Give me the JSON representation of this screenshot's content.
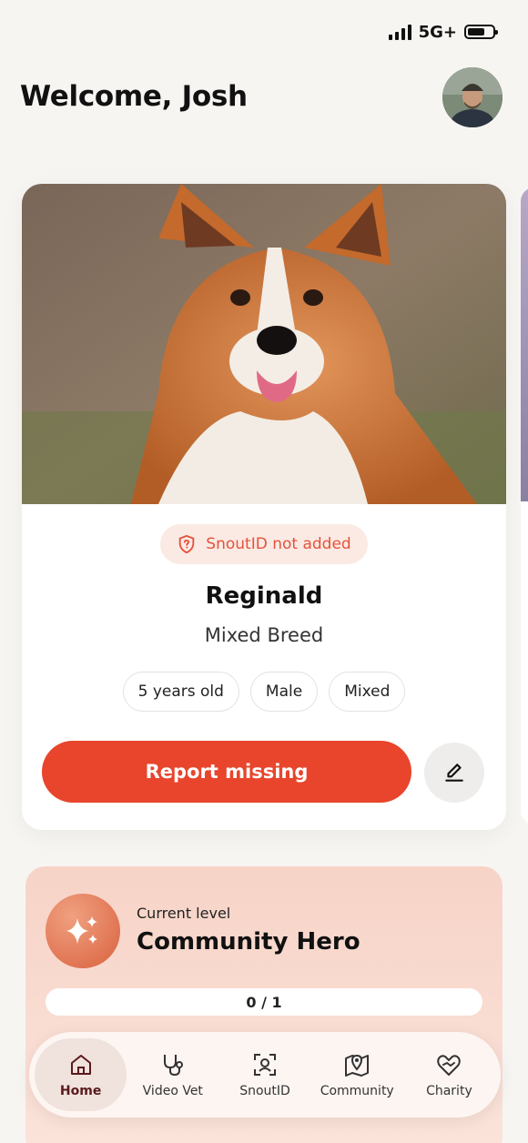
{
  "status_bar": {
    "network": "5G+"
  },
  "header": {
    "welcome": "Welcome, Josh"
  },
  "pet": {
    "snout_badge": "SnoutID not added",
    "name": "Reginald",
    "breed": "Mixed Breed",
    "tags": [
      "5 years old",
      "Male",
      "Mixed"
    ],
    "report_label": "Report missing"
  },
  "level": {
    "label": "Current level",
    "name": "Community Hero",
    "progress": "0 / 1"
  },
  "nav": {
    "items": [
      {
        "label": "Home",
        "icon": "home-icon"
      },
      {
        "label": "Video Vet",
        "icon": "stethoscope-icon"
      },
      {
        "label": "SnoutID",
        "icon": "face-scan-icon"
      },
      {
        "label": "Community",
        "icon": "map-pin-icon"
      },
      {
        "label": "Charity",
        "icon": "heart-hands-icon"
      }
    ]
  },
  "colors": {
    "accent": "#e8452c",
    "badge_bg": "#fbe9e4",
    "level_bg": "#f7d3c7"
  }
}
